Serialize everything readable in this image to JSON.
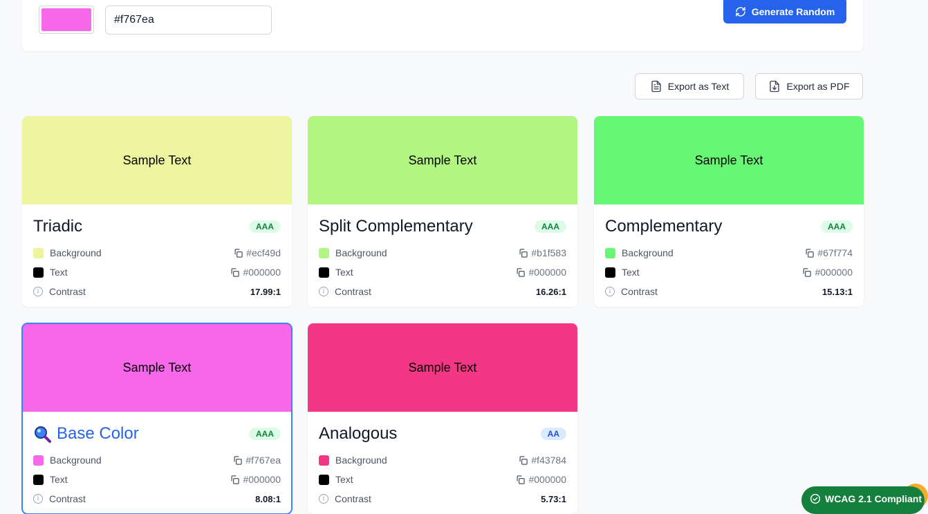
{
  "picker": {
    "hex_value": "#f767ea",
    "swatch_color": "#f767ea",
    "generate_label": "Generate Random"
  },
  "export": {
    "text_label": "Export as Text",
    "pdf_label": "Export as PDF"
  },
  "labels": {
    "background": "Background",
    "text": "Text",
    "contrast": "Contrast",
    "sample": "Sample Text"
  },
  "cards": [
    {
      "title": "Triadic",
      "badge": "AAA",
      "bg": "#ecf49d",
      "bg_display": "#ecf49d",
      "text_color": "#000000",
      "text_display": "#000000",
      "contrast": "17.99:1"
    },
    {
      "title": "Split Complementary",
      "badge": "AAA",
      "bg": "#b1f583",
      "bg_display": "#b1f583",
      "text_color": "#000000",
      "text_display": "#000000",
      "contrast": "16.26:1"
    },
    {
      "title": "Complementary",
      "badge": "AAA",
      "bg": "#67f774",
      "bg_display": "#67f774",
      "text_color": "#000000",
      "text_display": "#000000",
      "contrast": "15.13:1"
    },
    {
      "title": "Base Color",
      "badge": "AAA",
      "bg": "#f767ea",
      "bg_display": "#f767ea",
      "text_color": "#000000",
      "text_display": "#000000",
      "contrast": "8.08:1",
      "selected": true,
      "icon": "magnifier-icon"
    },
    {
      "title": "Analogous",
      "badge": "AA",
      "bg": "#f43784",
      "bg_display": "#f43784",
      "text_color": "#000000",
      "text_display": "#000000",
      "contrast": "5.73:1"
    }
  ],
  "wcag_badge": "WCAG 2.1 Compliant",
  "colors": {
    "accent": "#2563eb",
    "aaa_badge_bg": "#dcfce7",
    "aa_badge_bg": "#dbeafe",
    "compliance": "#15803d"
  }
}
